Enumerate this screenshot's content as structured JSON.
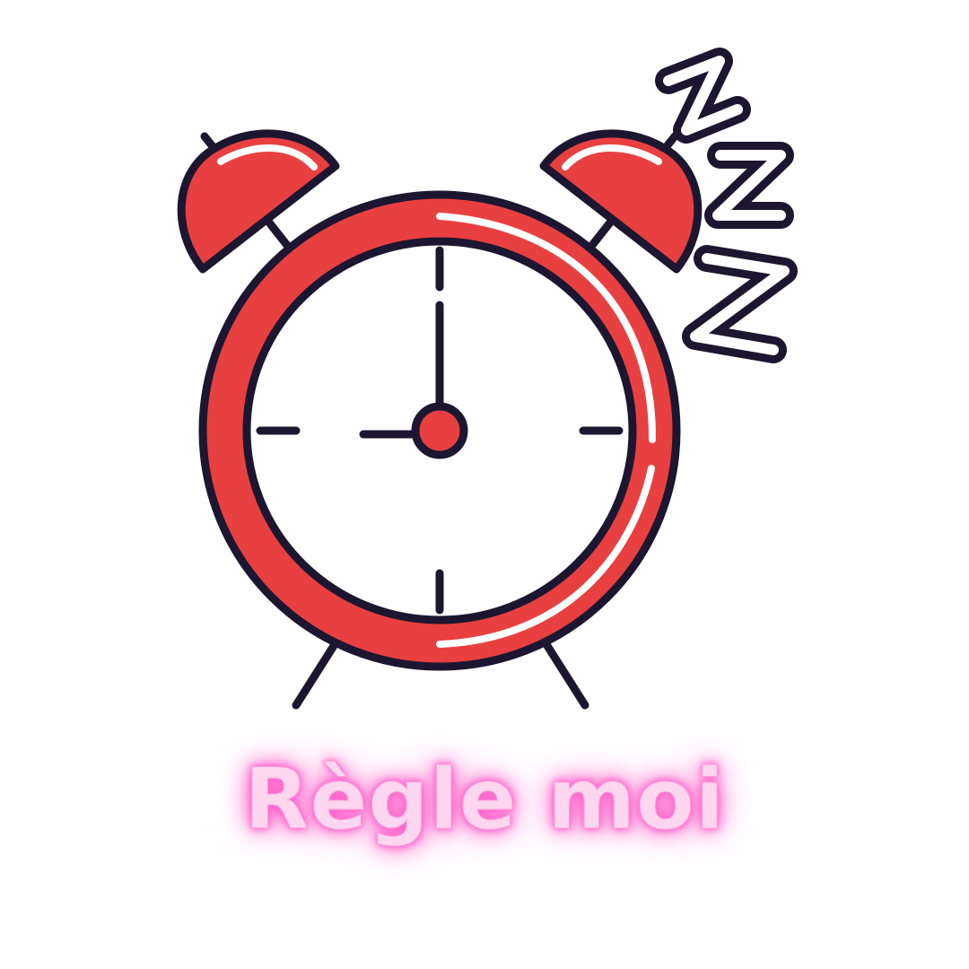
{
  "caption": "Règle moi",
  "icons": {
    "clock": "alarm-clock-icon",
    "sleep": "zzz-icon"
  },
  "colors": {
    "background": "#ffffff",
    "clock_body": "#e84040",
    "outline": "#1c1630",
    "highlight": "#ffffff",
    "caption_fill": "#ffd6f0",
    "caption_glow": "#ff4fc4"
  },
  "clock_time": "9:00"
}
